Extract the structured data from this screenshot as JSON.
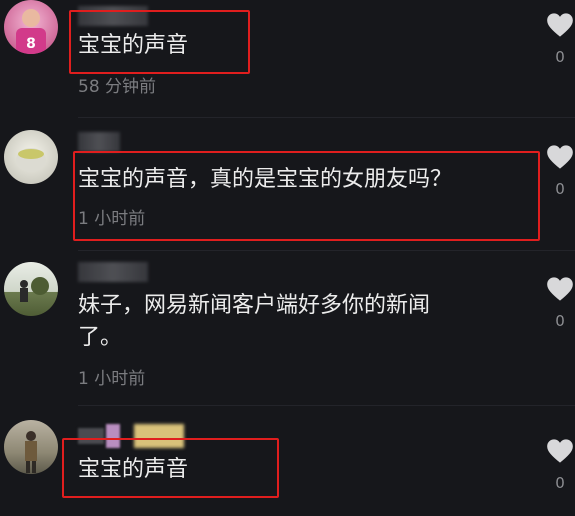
{
  "colors": {
    "background": "#16171b",
    "text": "#ececec",
    "meta": "#7b7c80",
    "highlight": "#e01e1e"
  },
  "comments": [
    {
      "text_lines": [
        "宝宝的声音"
      ],
      "time": "58 分钟前",
      "likes": "0",
      "avatar_label": "8"
    },
    {
      "text_lines": [
        "宝宝的声音，真的是宝宝的女朋友吗？"
      ],
      "time": "1 小时前",
      "likes": "0"
    },
    {
      "text_lines": [
        "妹子，网易新闻客户端好多你的新闻",
        "了。"
      ],
      "time": "1 小时前",
      "likes": "0"
    },
    {
      "text_lines": [
        "宝宝的声音"
      ],
      "likes": "0"
    }
  ],
  "icons": {
    "like": "heart-icon"
  }
}
